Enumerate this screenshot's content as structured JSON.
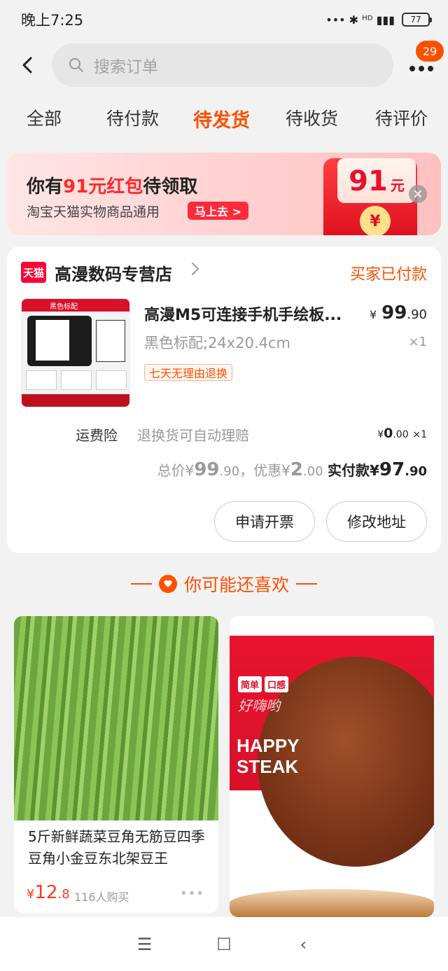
{
  "status_bar": {
    "time": "晚上7:25",
    "signal_icons": "••• ✱ ᴴᴰ ▮▮▮",
    "battery": "77"
  },
  "header": {
    "search_placeholder": "搜索订单",
    "notification_count": "29"
  },
  "tabs": [
    {
      "label": "全部"
    },
    {
      "label": "待付款"
    },
    {
      "label": "待发货"
    },
    {
      "label": "待收货"
    },
    {
      "label": "待评价"
    }
  ],
  "banner": {
    "title_prefix": "你有",
    "title_highlight": "91元红包",
    "title_suffix": "待领取",
    "subtitle": "淘宝天猫实物商品通用",
    "button": "马上去 >",
    "coupon_amount": "91",
    "coupon_unit": "元",
    "yen": "¥"
  },
  "order": {
    "shop_logo": "天猫",
    "shop_name": "高漫数码专营店",
    "status": "买家已付款",
    "product": {
      "image_title": "黑色标配",
      "title": "高漫M5可连接手机手绘板...",
      "price_currency": "¥",
      "price_int": "99",
      "price_dec": ".90",
      "sku": "黑色标配;24x20.4cm",
      "qty": "×1",
      "tag": "七天无理由退换"
    },
    "insurance": {
      "label": "运费险",
      "desc": "退换货可自动理赔",
      "price_currency": "¥",
      "price_int": "0",
      "price_dec": ".00",
      "qty": "×1"
    },
    "totals": {
      "total_label": "总价¥",
      "total_int": "99",
      "total_dec": ".90",
      "discount_label": "，优惠¥",
      "discount_int": "2",
      "discount_dec": ".00",
      "paid_label": "实付款¥",
      "paid_int": "97",
      "paid_dec": ".90"
    },
    "buttons": {
      "invoice": "申请开票",
      "address": "修改地址"
    }
  },
  "recommend": {
    "title": "你可能还喜欢",
    "items": [
      {
        "name": "5斤新鲜蔬菜豆角无筋豆四季豆角小金豆东北架豆王",
        "price_currency": "¥",
        "price_int": "12",
        "price_dec": ".8",
        "sold": "116人购买",
        "more": "•••"
      },
      {
        "tag1": "简单",
        "tag2": "口感",
        "script": "好嗨哟",
        "headline1": "HAPPY",
        "headline2": "STEAK"
      }
    ]
  },
  "nav": {
    "menu": "☰",
    "home": "☐",
    "back": "‹"
  },
  "colors": {
    "accent": "#ff5000",
    "red": "#e8102a",
    "background": "#f2f2f2"
  }
}
